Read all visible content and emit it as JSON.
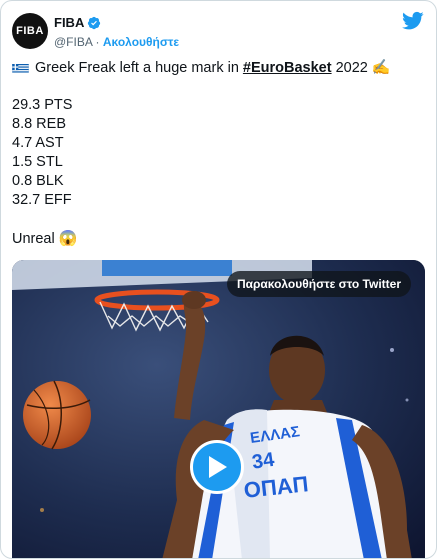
{
  "account": {
    "avatar_text": "FIBA",
    "display_name": "FIBA",
    "handle": "@FIBA",
    "separator": " · ",
    "follow_label": "Ακολουθήστε",
    "verified_icon": "verified-badge-icon",
    "platform_icon": "twitter-bird-icon"
  },
  "tweet": {
    "headline_prefix": "Greek Freak left a huge mark in ",
    "hashtag": "#EuroBasket",
    "headline_suffix": " 2022 ",
    "headline_emoji": "✍️",
    "stats": [
      "29.3 PTS",
      "8.8 REB",
      "4.7 AST",
      "1.5 STL",
      "0.8 BLK",
      "32.7 EFF"
    ],
    "closing_text": "Unreal ",
    "closing_emoji": "😱"
  },
  "media": {
    "watch_label": "Παρακολουθήστε στο Twitter",
    "jersey_text": "ΕΛΛΑΣ",
    "jersey_number": "34",
    "sponsor_text": "ΟΠΑΠ",
    "play_icon": "play-icon"
  },
  "colors": {
    "accent": "#1d9bf0",
    "text": "#0f1419",
    "muted": "#536471",
    "flag_blue": "#0d5eaf"
  }
}
